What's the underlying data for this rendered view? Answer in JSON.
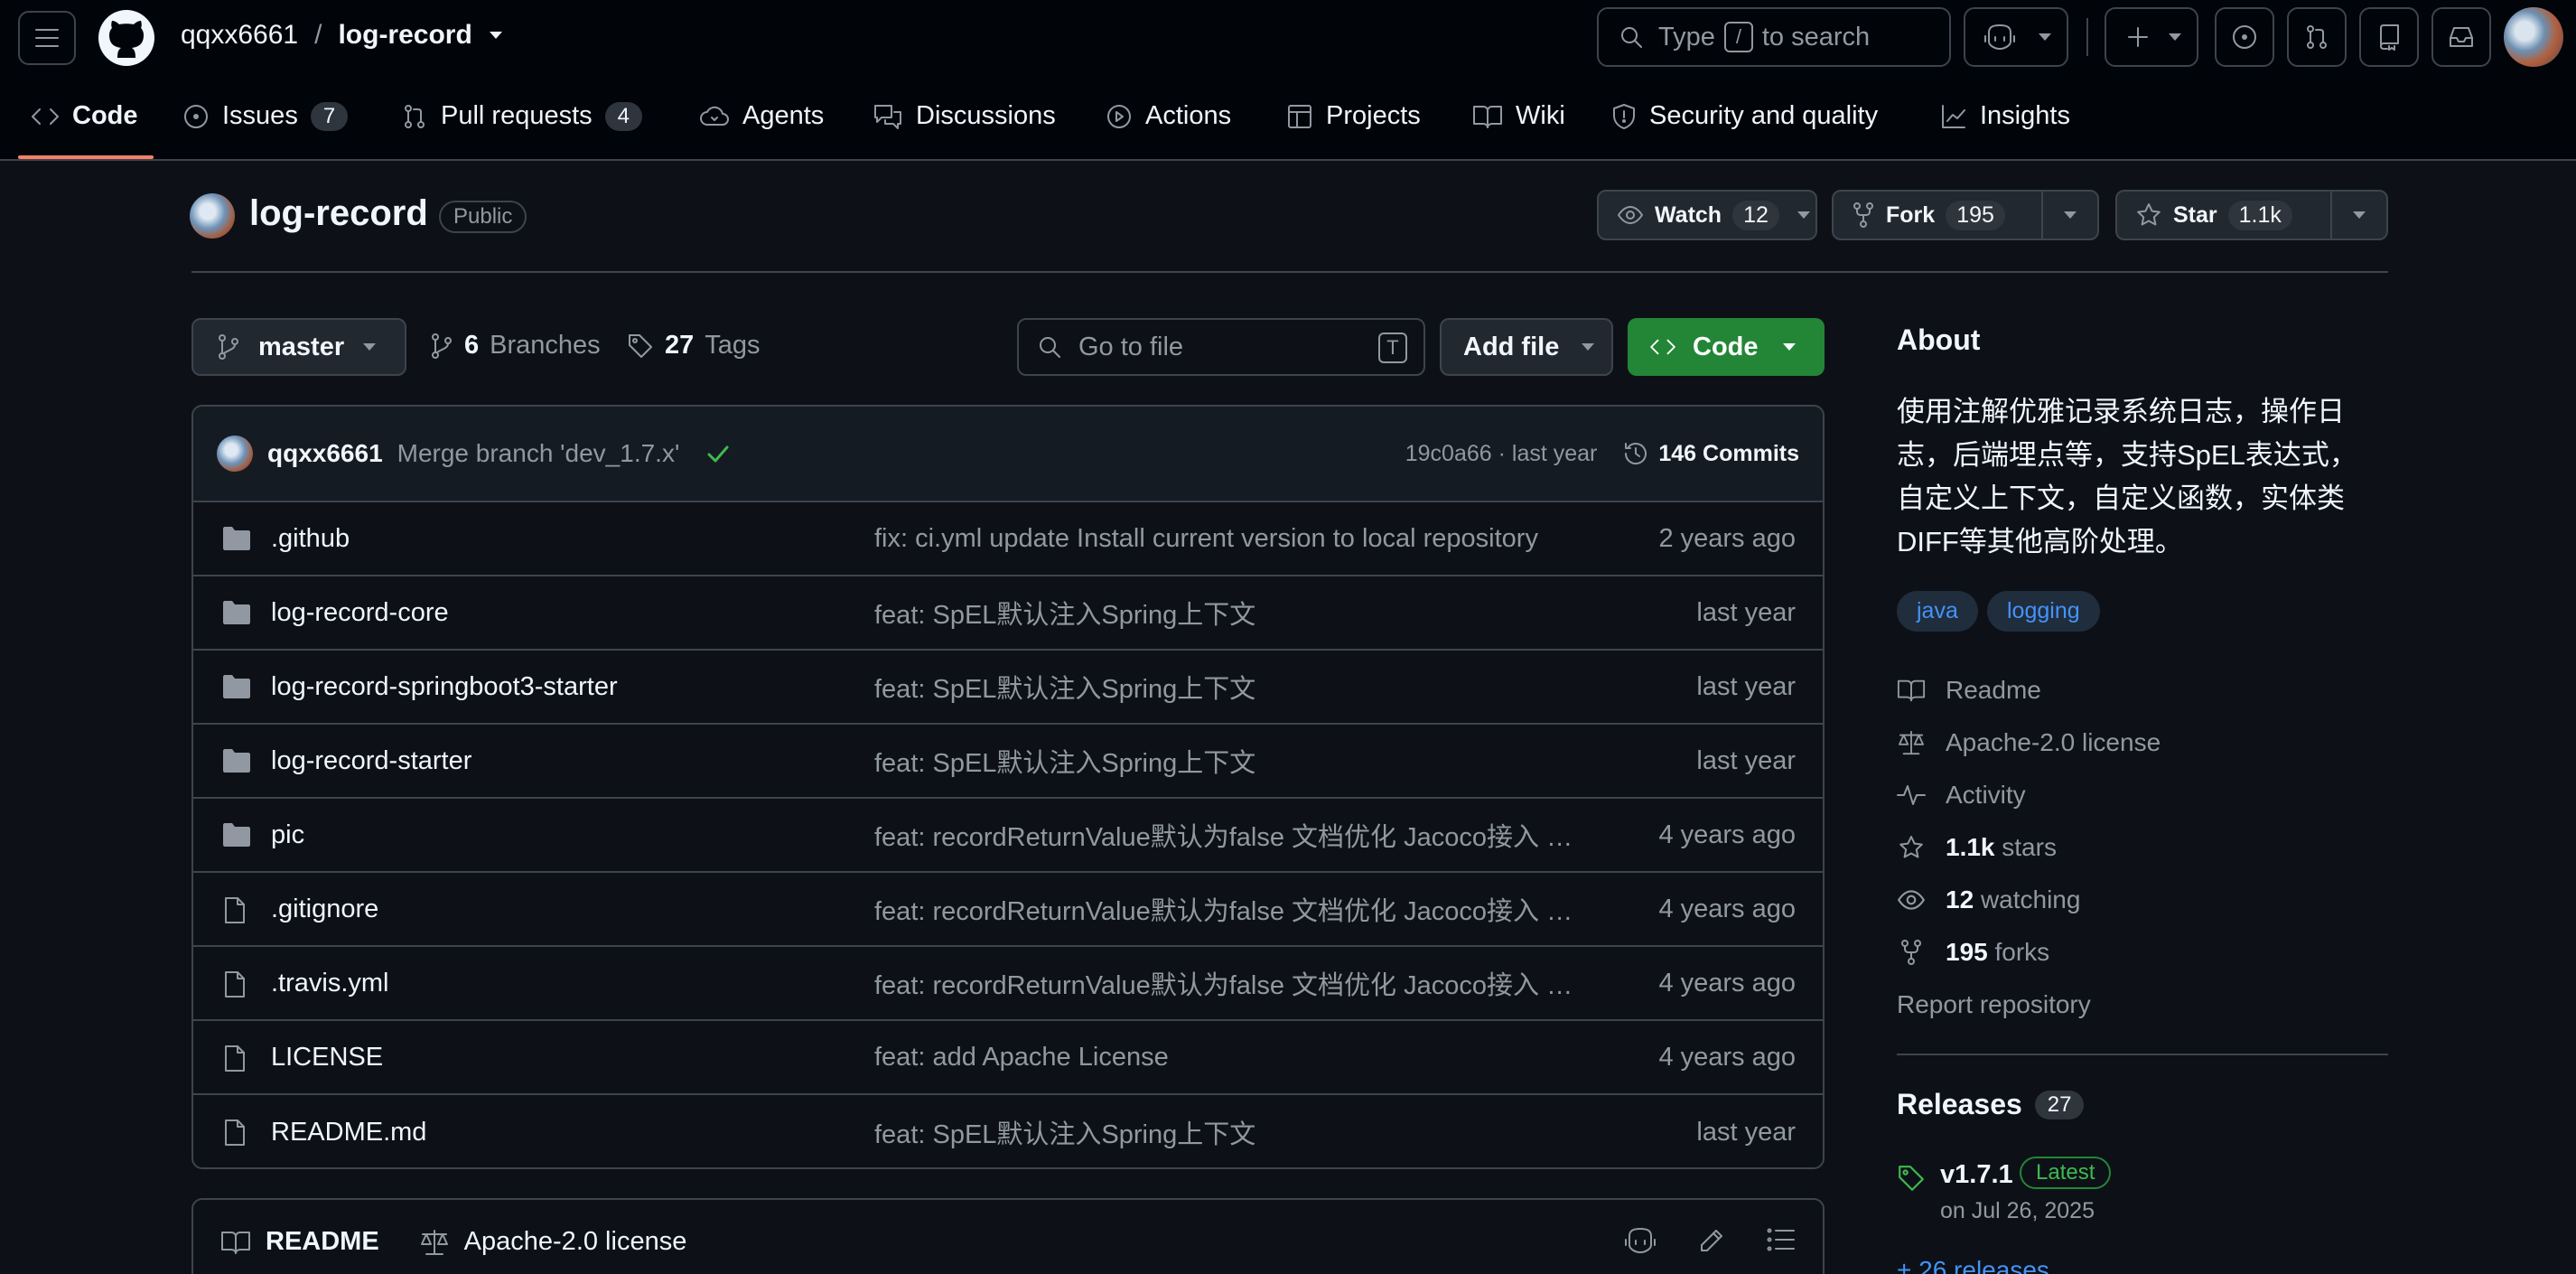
{
  "header": {
    "owner": "qqxx6661",
    "separator": "/",
    "repo": "log-record",
    "search_prefix": "Type",
    "search_key": "/",
    "search_suffix": "to search"
  },
  "nav": {
    "tabs": [
      {
        "label": "Code",
        "count": null
      },
      {
        "label": "Issues",
        "count": "7"
      },
      {
        "label": "Pull requests",
        "count": "4"
      },
      {
        "label": "Agents",
        "count": null
      },
      {
        "label": "Discussions",
        "count": null
      },
      {
        "label": "Actions",
        "count": null
      },
      {
        "label": "Projects",
        "count": null
      },
      {
        "label": "Wiki",
        "count": null
      },
      {
        "label": "Security and quality",
        "count": null
      },
      {
        "label": "Insights",
        "count": null
      }
    ],
    "active_color": "#f78166"
  },
  "repo": {
    "title": "log-record",
    "visibility": "Public",
    "watch_label": "Watch",
    "watch_count": "12",
    "fork_label": "Fork",
    "fork_count": "195",
    "star_label": "Star",
    "star_count": "1.1k"
  },
  "toolbar": {
    "branch": "master",
    "branches_count": "6",
    "branches_label": "Branches",
    "tags_count": "27",
    "tags_label": "Tags",
    "goto_placeholder": "Go to file",
    "goto_key": "T",
    "add_file": "Add file",
    "code": "Code",
    "code_color": "#238636"
  },
  "commit": {
    "author": "qqxx6661",
    "message": "Merge branch 'dev_1.7.x'",
    "hash_time": "19c0a66 · last year",
    "commits": "146 Commits"
  },
  "files": [
    {
      "type": "dir",
      "name": ".github",
      "message": "fix: ci.yml update Install current version to local repository",
      "date": "2 years ago"
    },
    {
      "type": "dir",
      "name": "log-record-core",
      "message": "feat: SpEL默认注入Spring上下文",
      "date": "last year"
    },
    {
      "type": "dir",
      "name": "log-record-springboot3-starter",
      "message": "feat: SpEL默认注入Spring上下文",
      "date": "last year"
    },
    {
      "type": "dir",
      "name": "log-record-starter",
      "message": "feat: SpEL默认注入Spring上下文",
      "date": "last year"
    },
    {
      "type": "dir",
      "name": "pic",
      "message": "feat: recordReturnValue默认为false 文档优化 Jacoco接入 c...",
      "date": "4 years ago"
    },
    {
      "type": "file",
      "name": ".gitignore",
      "message": "feat: recordReturnValue默认为false 文档优化 Jacoco接入 c...",
      "date": "4 years ago"
    },
    {
      "type": "file",
      "name": ".travis.yml",
      "message": "feat: recordReturnValue默认为false 文档优化 Jacoco接入 c...",
      "date": "4 years ago"
    },
    {
      "type": "file",
      "name": "LICENSE",
      "message": "feat: add Apache License",
      "date": "4 years ago"
    },
    {
      "type": "file",
      "name": "README.md",
      "message": "feat: SpEL默认注入Spring上下文",
      "date": "last year"
    }
  ],
  "readme_bar": {
    "readme": "README",
    "license": "Apache-2.0 license"
  },
  "about": {
    "heading": "About",
    "description": "使用注解优雅记录系统日志，操作日志，后端埋点等，支持SpEL表达式，自定义上下文，自定义函数，实体类DIFF等其他高阶处理。",
    "topics": [
      "java",
      "logging"
    ],
    "readme": "Readme",
    "license": "Apache-2.0 license",
    "activity": "Activity",
    "stars_count": "1.1k",
    "stars_label": "stars",
    "watching_count": "12",
    "watching_label": "watching",
    "forks_count": "195",
    "forks_label": "forks",
    "report": "Report repository"
  },
  "releases": {
    "heading": "Releases",
    "count": "27",
    "version": "v1.7.1",
    "latest": "Latest",
    "date": "on Jul 26, 2025",
    "more": "+ 26 releases"
  }
}
